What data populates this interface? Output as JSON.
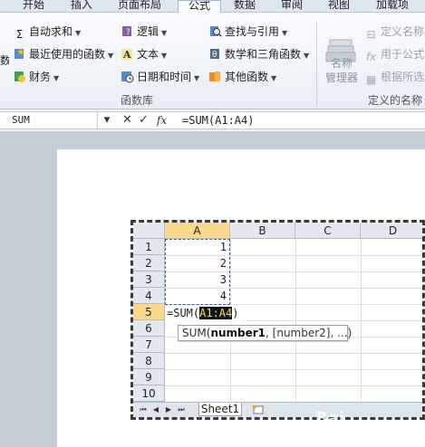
{
  "ribbon_tabs": [
    "开始",
    "插入",
    "页面布局",
    "公式",
    "数据",
    "审阅",
    "视图",
    "加载项"
  ],
  "active_tab": "公式",
  "function_library": {
    "autosum": "自动求和",
    "recent": "最近使用的函数",
    "financial": "财务",
    "logical": "逻辑",
    "text": "文本",
    "datetime": "日期和时间",
    "lookup": "查找与引用",
    "math": "数学和三角函数",
    "more": "其他函数",
    "left_fragment": "数",
    "group_label": "函数库"
  },
  "defined_names": {
    "name_manager_line1": "名称",
    "name_manager_line2": "管理器",
    "define_name": "定义名称",
    "use_in_formula": "用于公式",
    "create_from_selection": "根据所选",
    "group_label": "定义的名称"
  },
  "formula_bar": {
    "name_box": "SUM",
    "fx": "fx",
    "formula": "=SUM(A1:A4)"
  },
  "sheet": {
    "columns": [
      "A",
      "B",
      "C",
      "D"
    ],
    "rows": [
      "1",
      "2",
      "3",
      "4",
      "5",
      "6",
      "7",
      "8",
      "9",
      "10"
    ],
    "values": [
      "1",
      "2",
      "3",
      "4"
    ],
    "edit_prefix": "=SUM(",
    "edit_range": "A1:A4",
    "edit_suffix": ")",
    "tooltip_fn": "SUM(",
    "tooltip_arg1": "number1",
    "tooltip_rest": ", [number2], ...)",
    "tab_name": "Sheet1"
  },
  "watermark": "Bai"
}
